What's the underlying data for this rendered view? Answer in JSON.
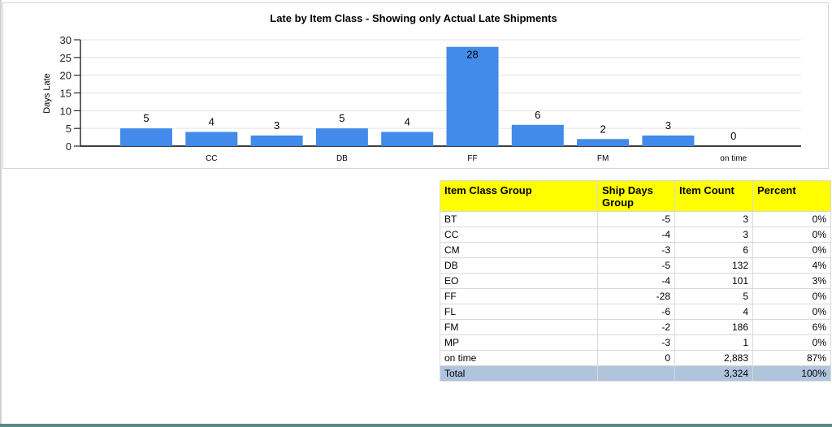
{
  "chart_data": {
    "type": "bar",
    "title": "Late by Item Class - Showing only Actual Late Shipments",
    "xlabel": "",
    "ylabel": "Days Late",
    "ylim": [
      0,
      30
    ],
    "yticks": [
      "0",
      "5",
      "10",
      "15",
      "20",
      "25",
      "30"
    ],
    "grid": true,
    "categories": [
      "BT",
      "CC",
      "CM",
      "DB",
      "EO",
      "FF",
      "FL",
      "FM",
      "MP",
      "on time"
    ],
    "shown_category_labels": [
      "",
      "CC",
      "",
      "DB",
      "",
      "FF",
      "",
      "FM",
      "",
      "on time"
    ],
    "values": [
      5,
      4,
      3,
      5,
      4,
      28,
      6,
      2,
      3,
      0
    ],
    "bar_color": "#428bea"
  },
  "table": {
    "headers": [
      "Item Class Group",
      "Ship Days Group",
      "Item Count",
      "Percent"
    ],
    "rows": [
      [
        "BT",
        "-5",
        "3",
        "0%"
      ],
      [
        "CC",
        "-4",
        "3",
        "0%"
      ],
      [
        "CM",
        "-3",
        "6",
        "0%"
      ],
      [
        "DB",
        "-5",
        "132",
        "4%"
      ],
      [
        "EO",
        "-4",
        "101",
        "3%"
      ],
      [
        "FF",
        "-28",
        "5",
        "0%"
      ],
      [
        "FL",
        "-6",
        "4",
        "0%"
      ],
      [
        "FM",
        "-2",
        "186",
        "6%"
      ],
      [
        "MP",
        "-3",
        "1",
        "0%"
      ],
      [
        "on time",
        "0",
        "2,883",
        "87%"
      ]
    ],
    "total": [
      "Total",
      "",
      "3,324",
      "100%"
    ]
  }
}
